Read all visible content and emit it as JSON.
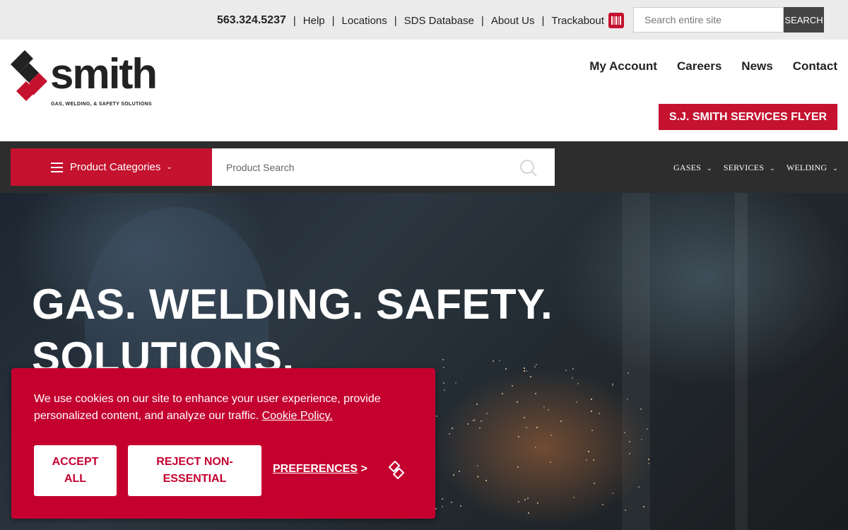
{
  "utility": {
    "phone": "563.324.5237",
    "links": [
      "Help",
      "Locations",
      "SDS Database",
      "About Us",
      "Trackabout"
    ],
    "search_placeholder": "Search entire site",
    "search_button": "SEARCH"
  },
  "header": {
    "logo_word": "smith",
    "logo_tagline": "GAS, WELDING, & SAFETY SOLUTIONS",
    "nav": [
      "My Account",
      "Careers",
      "News",
      "Contact"
    ],
    "flyer_button": "S.J. SMITH SERVICES FLYER"
  },
  "product_bar": {
    "categories_label": "Product Categories",
    "search_placeholder": "Product Search",
    "sub_nav": [
      "GASES",
      "SERVICES",
      "WELDING"
    ]
  },
  "hero": {
    "line1": "GAS. WELDING. SAFETY.",
    "line2": "SOLUTIONS."
  },
  "cookie_banner": {
    "text": "We use cookies on our site to enhance your user experience, provide personalized content, and analyze our traffic.",
    "policy_link": "Cookie Policy.",
    "accept_line1": "ACCEPT",
    "accept_line2": "ALL",
    "reject_line1": "REJECT NON-",
    "reject_line2": "ESSENTIAL",
    "preferences": "PREFERENCES",
    "preferences_arrow": ">"
  },
  "colors": {
    "brand_red": "#c4122f",
    "cookie_red": "#c4002f",
    "dark_bar": "#2d2d2d",
    "utility_bg": "#ebebeb"
  },
  "icons": [
    "trackabout-barcode-icon",
    "hamburger-icon",
    "chevron-down-icon",
    "search-icon",
    "smith-logo-mark-icon",
    "cookie-brand-icon"
  ]
}
